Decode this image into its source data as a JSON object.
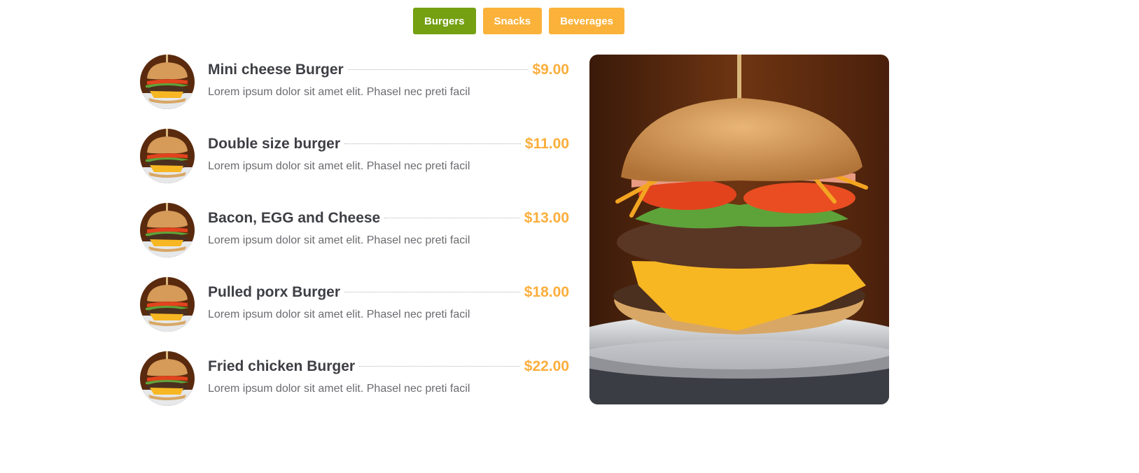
{
  "tabs": [
    {
      "label": "Burgers",
      "active": true
    },
    {
      "label": "Snacks",
      "active": false
    },
    {
      "label": "Beverages",
      "active": false
    }
  ],
  "colors": {
    "active_tab": "#74a012",
    "inactive_tab": "#fbb23a",
    "price": "#fbae3c",
    "heading": "#3e3f44",
    "description": "#6b6b70"
  },
  "menu": {
    "items": [
      {
        "name": "Mini cheese Burger",
        "price": "$9.00",
        "description": "Lorem ipsum dolor sit amet elit. Phasel nec preti facil",
        "image": "burger-thumbnail"
      },
      {
        "name": "Double size burger",
        "price": "$11.00",
        "description": "Lorem ipsum dolor sit amet elit. Phasel nec preti facil",
        "image": "burger-thumbnail"
      },
      {
        "name": "Bacon, EGG and Cheese",
        "price": "$13.00",
        "description": "Lorem ipsum dolor sit amet elit. Phasel nec preti facil",
        "image": "burger-thumbnail"
      },
      {
        "name": "Pulled porx Burger",
        "price": "$18.00",
        "description": "Lorem ipsum dolor sit amet elit. Phasel nec preti facil",
        "image": "burger-thumbnail"
      },
      {
        "name": "Fried chicken Burger",
        "price": "$22.00",
        "description": "Lorem ipsum dolor sit amet elit. Phasel nec preti facil",
        "image": "burger-thumbnail"
      }
    ]
  },
  "hero": {
    "image": "cheeseburger-photo"
  }
}
